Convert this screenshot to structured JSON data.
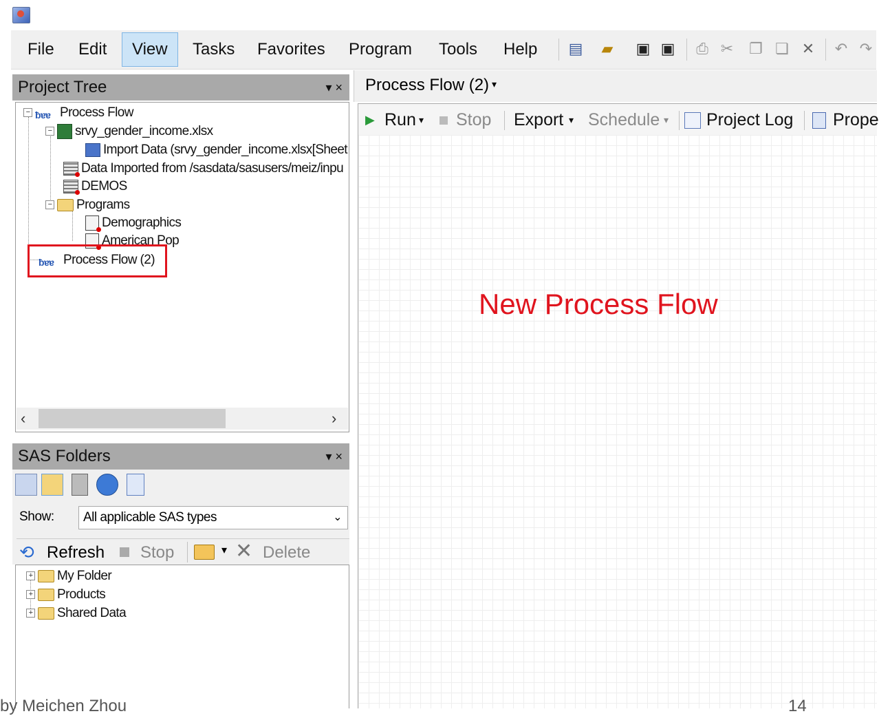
{
  "menu": [
    "File",
    "Edit",
    "View",
    "Tasks",
    "Favorites",
    "Program",
    "Tools",
    "Help"
  ],
  "menu_active": "View",
  "project_tree": {
    "title": "Project Tree",
    "controls": "▾ ×",
    "items": [
      {
        "label": "Process Flow",
        "icon": "process-flow-icon"
      },
      {
        "label": "srvy_gender_income.xlsx",
        "icon": "excel-file-icon"
      },
      {
        "label": "Import Data (srvy_gender_income.xlsx[Sheet",
        "icon": "import-data-icon"
      },
      {
        "label": "Data Imported from /sasdata/sasusers/meiz/inpu",
        "icon": "dataset-icon"
      },
      {
        "label": "DEMOS",
        "icon": "dataset-icon"
      },
      {
        "label": "Programs",
        "icon": "folder-icon"
      },
      {
        "label": "Demographics",
        "icon": "program-icon"
      },
      {
        "label": "American Pop",
        "icon": "program-icon"
      },
      {
        "label": "Process Flow (2)",
        "icon": "process-flow-icon"
      }
    ]
  },
  "sas_folders": {
    "title": "SAS Folders",
    "controls": "▾ ×",
    "show_label": "Show:",
    "show_value": "All applicable SAS types",
    "toolbar": {
      "refresh": "Refresh",
      "stop": "Stop",
      "delete": "Delete"
    },
    "items": [
      "My Folder",
      "Products",
      "Shared Data"
    ]
  },
  "process_flow": {
    "tab_label": "Process Flow (2)",
    "toolbar": {
      "run": "Run",
      "stop": "Stop",
      "export": "Export",
      "schedule": "Schedule",
      "project_log": "Project Log",
      "properties": "Prope"
    },
    "canvas_label": "New Process Flow"
  },
  "footer": {
    "author": "by Meichen Zhou",
    "page": "14"
  },
  "colors": {
    "highlight": "#e0141e",
    "panel_header": "#a9a9a9",
    "menu_active": "#cce4f7"
  }
}
